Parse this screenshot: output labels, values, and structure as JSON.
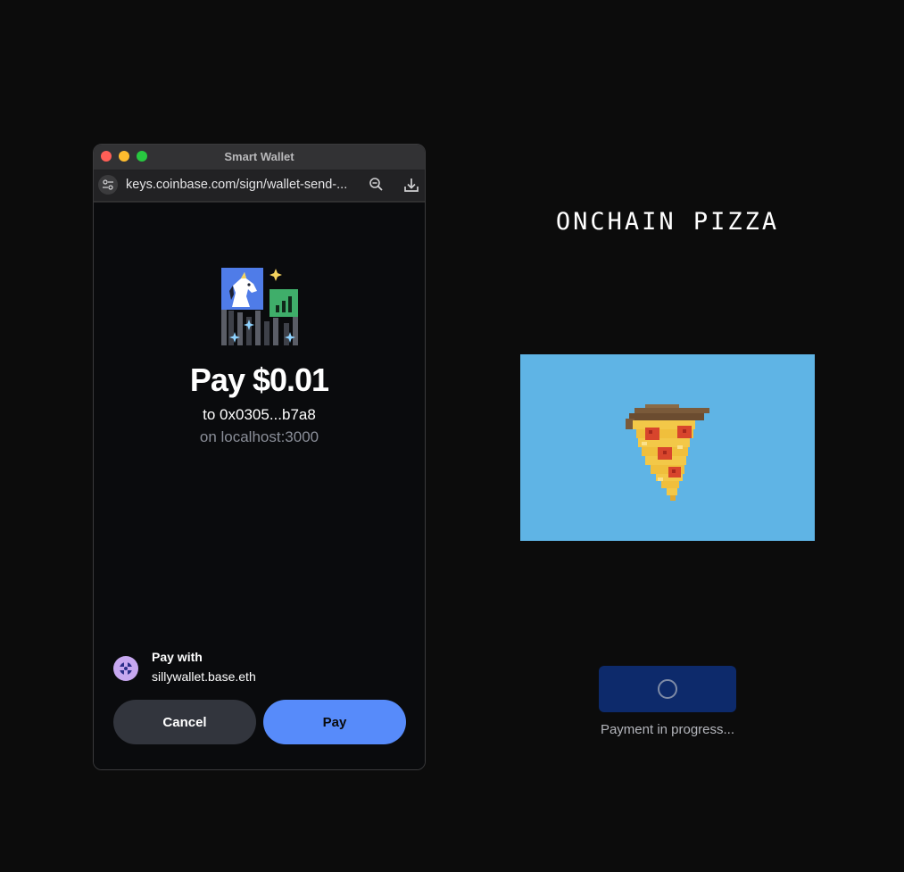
{
  "window": {
    "title": "Smart Wallet",
    "url": "keys.coinbase.com/sign/wallet-send-..."
  },
  "payment": {
    "amount_label": "Pay $0.01",
    "recipient_label": "to 0x0305...b7a8",
    "origin_label": "on localhost:3000",
    "pay_with_label": "Pay with",
    "account": "sillywallet.base.eth",
    "cancel_label": "Cancel",
    "pay_label": "Pay"
  },
  "app": {
    "title": "ONCHAIN PIZZA",
    "status": "Payment in progress..."
  },
  "colors": {
    "background": "#0c0c0c",
    "pay_button": "#578bfa",
    "cancel_button": "#32353d",
    "pizza_card": "#5fb4e5",
    "tx_button": "#0d2a6b"
  },
  "icons": {
    "hero": "unicorn-stock-sparkle-illustration",
    "avatar": "wallet-avatar-icon",
    "pizza": "pixel-pizza-slice",
    "loading": "spinner-icon"
  }
}
